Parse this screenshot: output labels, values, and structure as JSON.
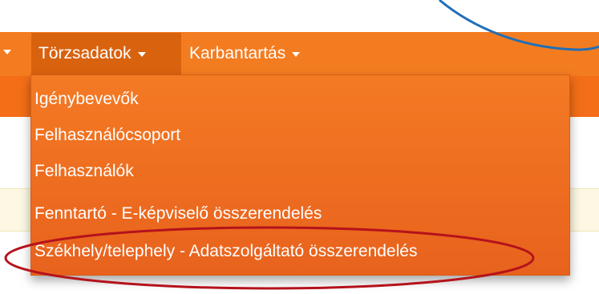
{
  "navbar": {
    "items": [
      {
        "label": "Törzsadatok",
        "active": true
      },
      {
        "label": "Karbantartás",
        "active": false
      }
    ]
  },
  "dropdown": {
    "items": [
      {
        "label": "Igénybevevők"
      },
      {
        "label": "Felhasználócsoport"
      },
      {
        "label": "Felhasználók"
      },
      {
        "label": "Fenntartó - E-képviselő összerendelés"
      },
      {
        "label": "Székhely/telephely - Adatszolgáltató összerendelés",
        "highlighted": true
      }
    ]
  },
  "colors": {
    "navbar": "#f47c20",
    "navbar_active": "#d9620f",
    "dropdown": "#ef6f20",
    "annotation_red": "#b5121b",
    "annotation_blue": "#1f6fb8",
    "alert_bg": "#fcf8e3"
  },
  "icons": [
    "caret-down-icon"
  ]
}
